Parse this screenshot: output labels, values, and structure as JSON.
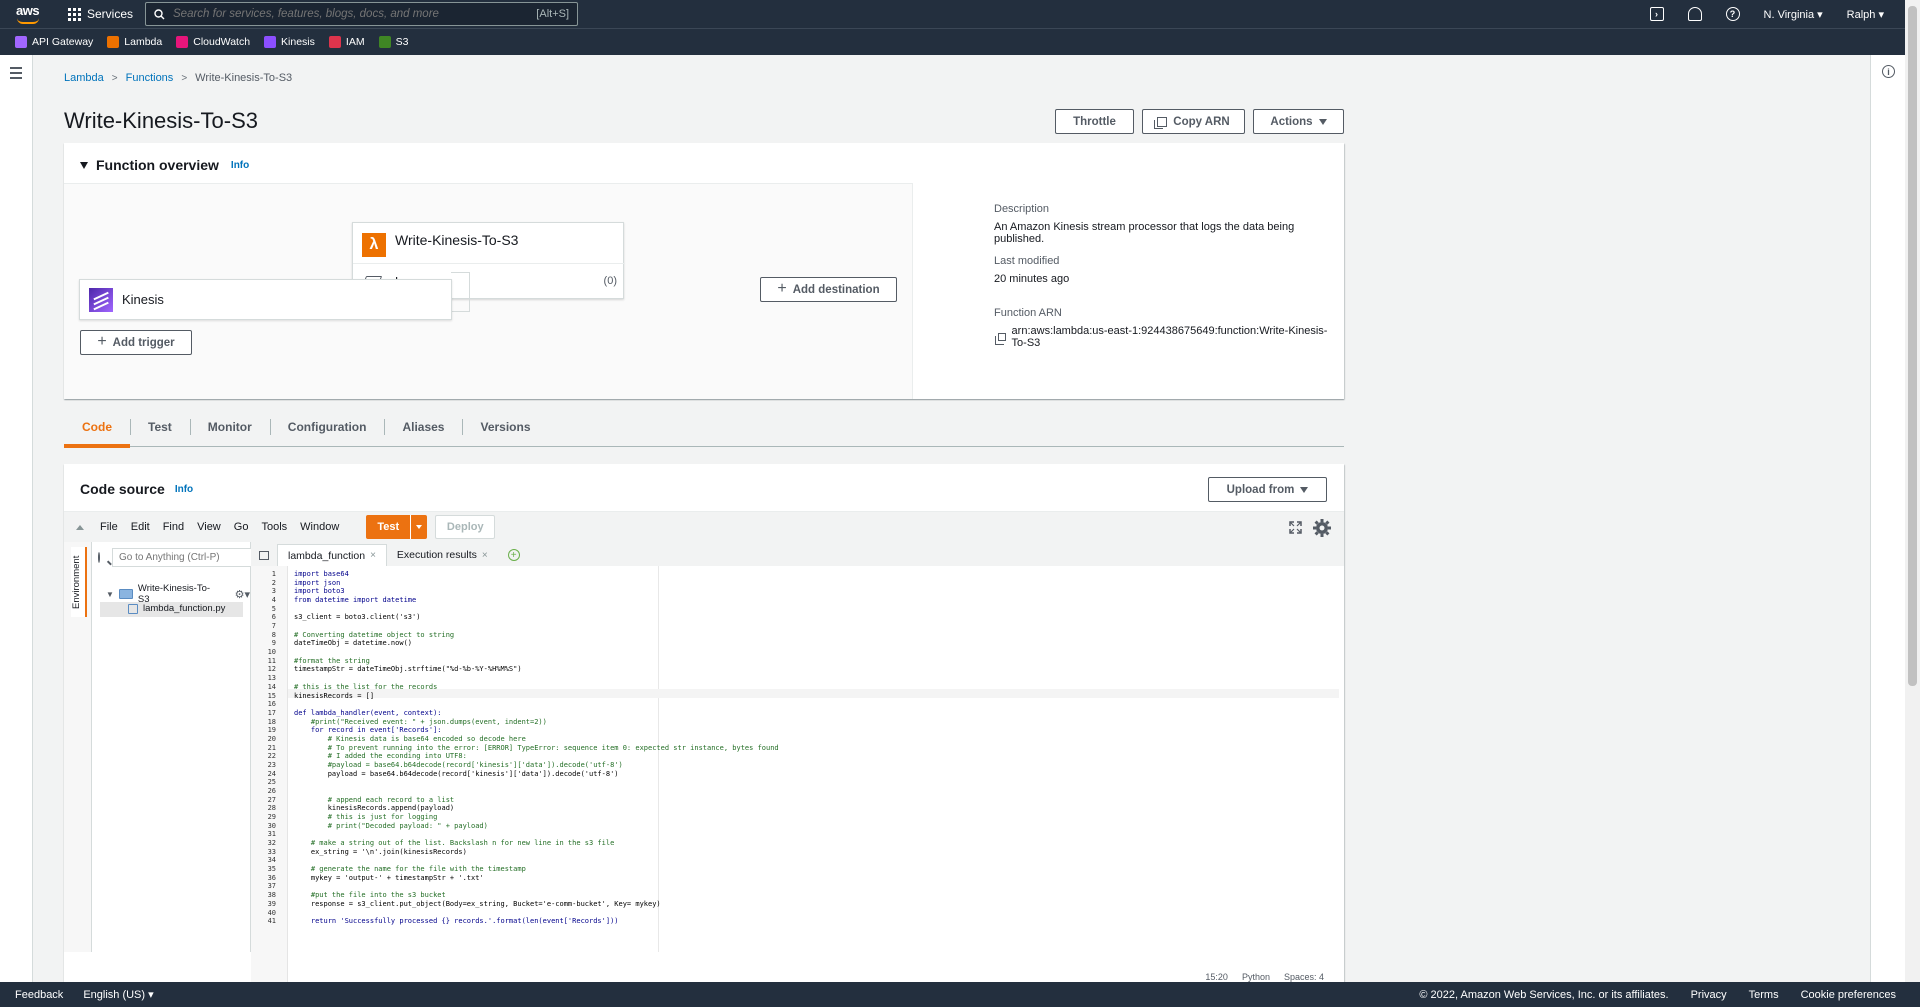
{
  "topnav": {
    "logo_text": "aws",
    "services_label": "Services",
    "search_placeholder": "Search for services, features, blogs, docs, and more",
    "search_shortcut": "[Alt+S]",
    "region": "N. Virginia",
    "user": "Ralph"
  },
  "favorites": [
    {
      "label": "API Gateway",
      "color": "#a166ff"
    },
    {
      "label": "Lambda",
      "color": "#ed7100"
    },
    {
      "label": "CloudWatch",
      "color": "#e7157b"
    },
    {
      "label": "Kinesis",
      "color": "#8c4fff"
    },
    {
      "label": "IAM",
      "color": "#dd344c"
    },
    {
      "label": "S3",
      "color": "#3f8624"
    }
  ],
  "breadcrumb": {
    "items": [
      "Lambda",
      "Functions"
    ],
    "current": "Write-Kinesis-To-S3"
  },
  "page_title": "Write-Kinesis-To-S3",
  "header_buttons": {
    "throttle": "Throttle",
    "copy_arn": "Copy ARN",
    "actions": "Actions"
  },
  "overview": {
    "title": "Function overview",
    "info": "Info",
    "function_name": "Write-Kinesis-To-S3",
    "layers_label": "Layers",
    "layers_count": "(0)",
    "trigger_name": "Kinesis",
    "add_trigger": "Add trigger",
    "add_destination": "Add destination",
    "description_label": "Description",
    "description_value": "An Amazon Kinesis stream processor that logs the data being published.",
    "last_modified_label": "Last modified",
    "last_modified_value": "20 minutes ago",
    "arn_label": "Function ARN",
    "arn_value": "arn:aws:lambda:us-east-1:924438675649:function:Write-Kinesis-To-S3"
  },
  "tabs": [
    "Code",
    "Test",
    "Monitor",
    "Configuration",
    "Aliases",
    "Versions"
  ],
  "code_source": {
    "title": "Code source",
    "info": "Info",
    "upload_from": "Upload from",
    "menu": [
      "File",
      "Edit",
      "Find",
      "View",
      "Go",
      "Tools",
      "Window"
    ],
    "test_label": "Test",
    "deploy_label": "Deploy",
    "goto_placeholder": "Go to Anything (Ctrl-P)",
    "environment_label": "Environment",
    "folder_name": "Write-Kinesis-To-S3",
    "file_name": "lambda_function.py",
    "editor_tabs": [
      "lambda_function",
      "Execution results"
    ],
    "status_position": "15:20",
    "status_language": "Python",
    "status_spaces": "Spaces: 4"
  },
  "code_lines": [
    "import base64",
    "import json",
    "import boto3",
    "from datetime import datetime",
    "",
    "s3_client = boto3.client('s3')",
    "",
    "# Converting datetime object to string",
    "dateTimeObj = datetime.now()",
    "",
    "#format the string",
    "timestampStr = dateTimeObj.strftime(\"%d-%b-%Y-%H%M%S\")",
    "",
    "# this is the list for the records",
    "kinesisRecords = []",
    "",
    "def lambda_handler(event, context):",
    "    #print(\"Received event: \" + json.dumps(event, indent=2))",
    "    for record in event['Records']:",
    "        # Kinesis data is base64 encoded so decode here",
    "        # To prevent running into the error: [ERROR] TypeError: sequence item 0: expected str instance, bytes found",
    "        # I added the econding into UTF8:",
    "        #payload = base64.b64decode(record['kinesis']['data']).decode('utf-8')",
    "        payload = base64.b64decode(record['kinesis']['data']).decode('utf-8')",
    "",
    "",
    "        # append each record to a list",
    "        kinesisRecords.append(payload)",
    "        # this is just for logging",
    "        # print(\"Decoded payload: \" + payload)",
    "",
    "    # make a string out of the list. Backslash n for new line in the s3 file",
    "    ex_string = '\\n'.join(kinesisRecords)",
    "",
    "    # generate the name for the file with the timestamp",
    "    mykey = 'output-' + timestampStr + '.txt'",
    "",
    "    #put the file into the s3 bucket",
    "    response = s3_client.put_object(Body=ex_string, Bucket='e-comm-bucket', Key= mykey)",
    "",
    "    return 'Successfully processed {} records.'.format(len(event['Records']))"
  ],
  "footer": {
    "feedback": "Feedback",
    "language": "English (US)",
    "copyright": "© 2022, Amazon Web Services, Inc. or its affiliates.",
    "privacy": "Privacy",
    "terms": "Terms",
    "cookies": "Cookie preferences"
  }
}
